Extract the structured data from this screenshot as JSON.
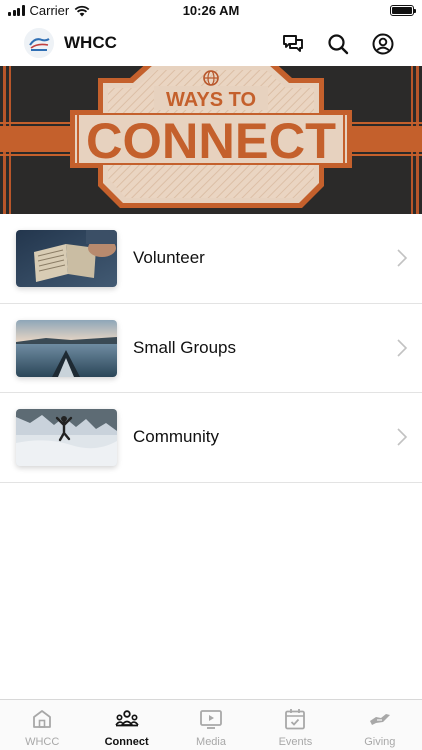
{
  "status_bar": {
    "carrier": "Carrier",
    "time": "10:26 AM"
  },
  "header": {
    "title": "WHCC",
    "icons": [
      "chat-icon",
      "search-icon",
      "profile-icon"
    ]
  },
  "banner": {
    "line1": "WAYS TO",
    "line2": "CONNECT",
    "colors": {
      "dark": "#2b2a29",
      "orange": "#c4602c",
      "cream": "#e7d2bf"
    }
  },
  "list": {
    "items": [
      {
        "label": "Volunteer",
        "thumb": "open-bible-photo"
      },
      {
        "label": "Small Groups",
        "thumb": "kayak-lake-photo"
      },
      {
        "label": "Community",
        "thumb": "snow-jump-photo"
      }
    ]
  },
  "tabs": [
    {
      "label": "WHCC",
      "icon": "home-icon",
      "active": false
    },
    {
      "label": "Connect",
      "icon": "people-icon",
      "active": true
    },
    {
      "label": "Media",
      "icon": "play-icon",
      "active": false
    },
    {
      "label": "Events",
      "icon": "calendar-icon",
      "active": false
    },
    {
      "label": "Giving",
      "icon": "giving-hand-icon",
      "active": false
    }
  ],
  "colors": {
    "active_tab": "#111111",
    "inactive_tab": "#a8a8a8",
    "divider": "#e3e3e3"
  }
}
